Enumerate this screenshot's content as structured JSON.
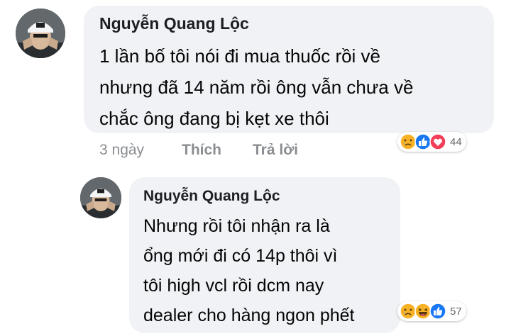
{
  "comments": [
    {
      "author": "Nguyễn Quang Lộc",
      "text": "1 lần bố tôi nói đi mua thuốc rồi về\nnhưng đã 14 năm rồi ông vẫn chưa về\nchắc ông đang bị kẹt xe thôi",
      "time": "3 ngày",
      "like_label": "Thích",
      "reply_label": "Trả lời",
      "reactions": [
        "sad",
        "like",
        "love"
      ],
      "reaction_count": "44"
    },
    {
      "author": "Nguyễn Quang Lộc",
      "text": "Nhưng rồi tôi nhận ra là\nổng mới đi có 14p thôi vì\ntôi high vcl rồi dcm nay\ndealer cho hàng ngon phết",
      "reactions": [
        "sad",
        "haha",
        "like"
      ],
      "reaction_count": "57"
    }
  ],
  "colors": {
    "bubble": "#f0f2f5",
    "meta_text": "#8a8d91",
    "like_blue": "#1877f2",
    "love_red": "#f33e58",
    "emoji_yellow": "#f7b125"
  }
}
